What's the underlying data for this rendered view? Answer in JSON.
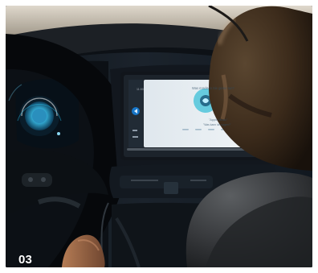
{
  "photo": {
    "number": "03",
    "infotainment": {
      "prompt": "Was möchten Sie gerne tun?",
      "voice_title": "\"Apple Music\"",
      "voice_subtitle": "\"Was kann ich sagen?\"",
      "side_time": "11:00"
    },
    "colors": {
      "screen_background": "#e7edf2",
      "screen_accent": "#58c7dc",
      "car_dark": "#11161d",
      "steering_wheel": "#090c10"
    }
  }
}
